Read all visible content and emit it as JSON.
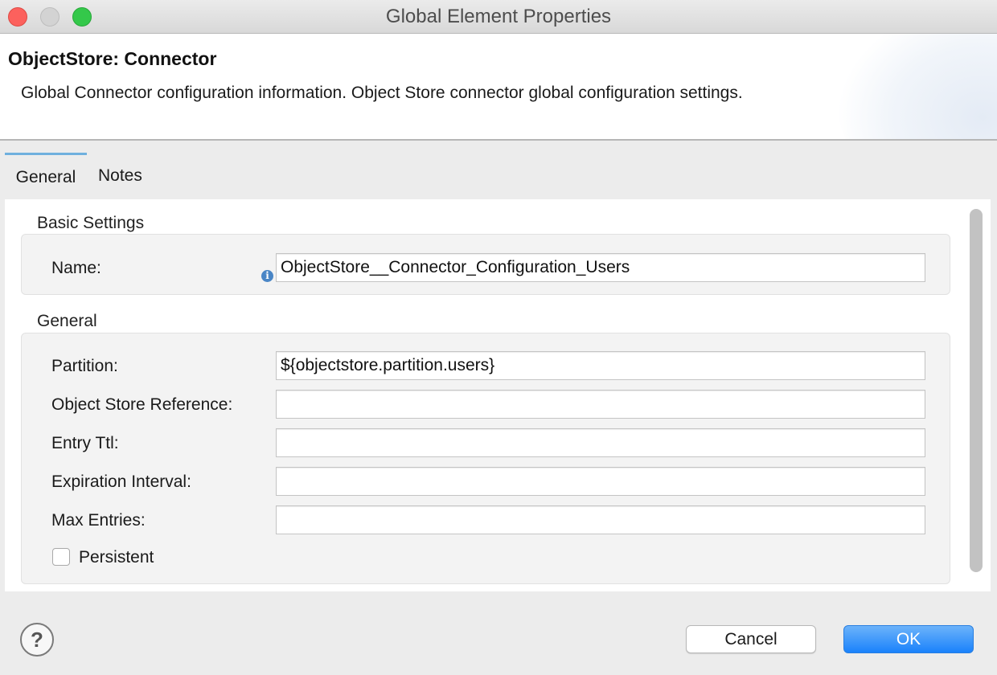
{
  "window": {
    "title": "Global Element Properties"
  },
  "header": {
    "title": "ObjectStore: Connector",
    "description": "Global Connector configuration information. Object Store connector global configuration settings."
  },
  "tabs": [
    {
      "label": "General",
      "selected": true
    },
    {
      "label": "Notes",
      "selected": false
    }
  ],
  "basic_settings": {
    "section_label": "Basic Settings",
    "name_label": "Name:",
    "name_value": "ObjectStore__Connector_Configuration_Users"
  },
  "general": {
    "section_label": "General",
    "fields": [
      {
        "label": "Partition:",
        "value": "${objectstore.partition.users}"
      },
      {
        "label": "Object Store Reference:",
        "value": ""
      },
      {
        "label": "Entry Ttl:",
        "value": ""
      },
      {
        "label": "Expiration Interval:",
        "value": ""
      },
      {
        "label": "Max Entries:",
        "value": ""
      }
    ],
    "persistent_label": "Persistent",
    "persistent_checked": false
  },
  "footer": {
    "help_glyph": "?",
    "cancel_label": "Cancel",
    "ok_label": "OK"
  },
  "icons": {
    "info": "info-icon",
    "help": "help-icon"
  },
  "colors": {
    "accent": "#1a82fb",
    "tab_indicator": "#6fb0de",
    "close": "#fc615d",
    "maximize": "#34c84a"
  }
}
